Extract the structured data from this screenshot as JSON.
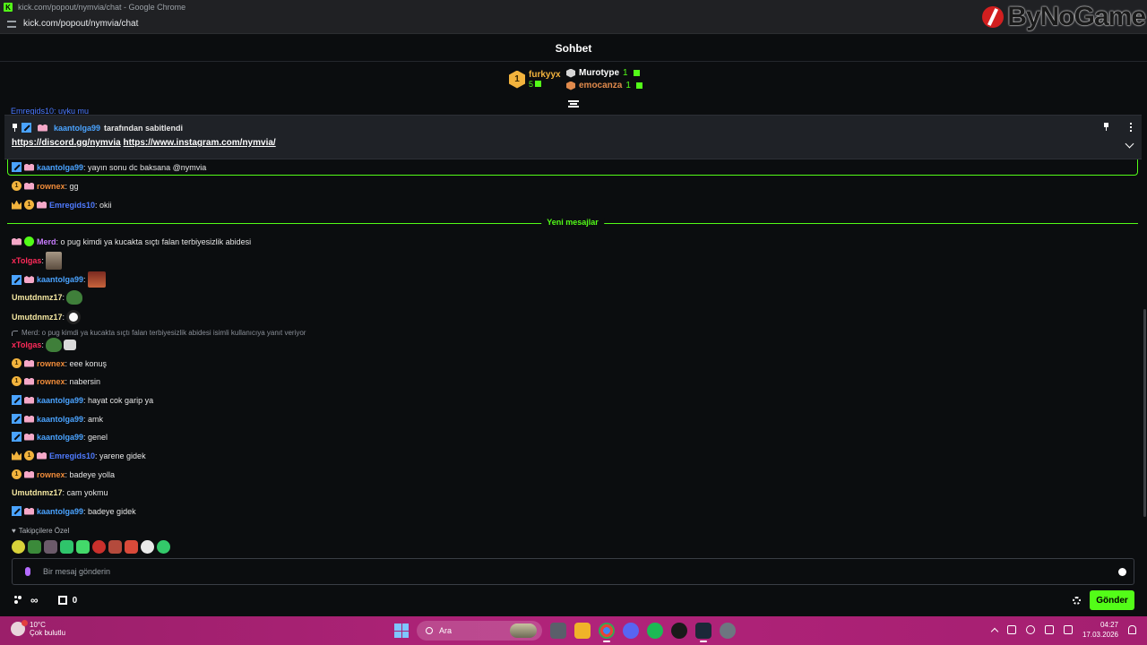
{
  "browser": {
    "title": "kick.com/popout/nymvia/chat - Google Chrome",
    "url": "kick.com/popout/nymvia/chat",
    "watermark": "ByNoGame"
  },
  "chat": {
    "header": "Sohbet",
    "leaderboard": {
      "top": {
        "rank": "1",
        "name": "furkyyx",
        "count": "5"
      },
      "others": [
        {
          "name": "Murotype",
          "count": "1"
        },
        {
          "name": "emocanza",
          "count": "1"
        }
      ]
    },
    "cut_message": "Emregids10: uyku mu",
    "pinned": {
      "user": "kaantolga99",
      "by_text": "tarafından sabitlendi",
      "link1": "https://discord.gg/nymvia",
      "link2": "https://www.instagram.com/nymvia/"
    },
    "new_messages_label": "Yeni mesajlar",
    "reply_context": "Merd: o pug kimdi ya kucakta sıçtı falan terbiyesizlik abidesi isimli kullanıcıya yanıt veriyor",
    "messages": [
      {
        "user": "kaantolga99",
        "text": ": yayın sonu dc baksana @nymvia"
      },
      {
        "user": "rownex",
        "text": ": gg"
      },
      {
        "user": "Emregids10",
        "text": ": okii"
      },
      {
        "user": "Merd",
        "text": ": o pug kimdi ya kucakta sıçtı falan terbiyesizlik abidesi"
      },
      {
        "user": "xTolgas",
        "text": ":"
      },
      {
        "user": "kaantolga99",
        "text": ":"
      },
      {
        "user": "Umutdnmz17",
        "text": ":"
      },
      {
        "user": "Umutdnmz17",
        "text": ":"
      },
      {
        "user": "xTolgas",
        "text": ":"
      },
      {
        "user": "rownex",
        "text": ": eee konuş"
      },
      {
        "user": "rownex",
        "text": ": nabersin"
      },
      {
        "user": "kaantolga99",
        "text": ": hayat cok garip ya"
      },
      {
        "user": "kaantolga99",
        "text": ": amk"
      },
      {
        "user": "kaantolga99",
        "text": ": genel"
      },
      {
        "user": "Emregids10",
        "text": ": yarene gidek"
      },
      {
        "user": "rownex",
        "text": ": badeye yolla"
      },
      {
        "user": "Umutdnmz17",
        "text": ": cam yokmu"
      },
      {
        "user": "kaantolga99",
        "text": ": badeye gidek"
      }
    ],
    "follower_emotes_label": "Takipçilere Özel",
    "input_placeholder": "Bir mesaj gönderin",
    "points": "0",
    "send_label": "Gönder",
    "badge_gold_label": "1"
  },
  "taskbar": {
    "temp": "10°C",
    "weather": "Çok bulutlu",
    "search": "Ara",
    "time": "04:27",
    "date": "17.03.2026"
  }
}
